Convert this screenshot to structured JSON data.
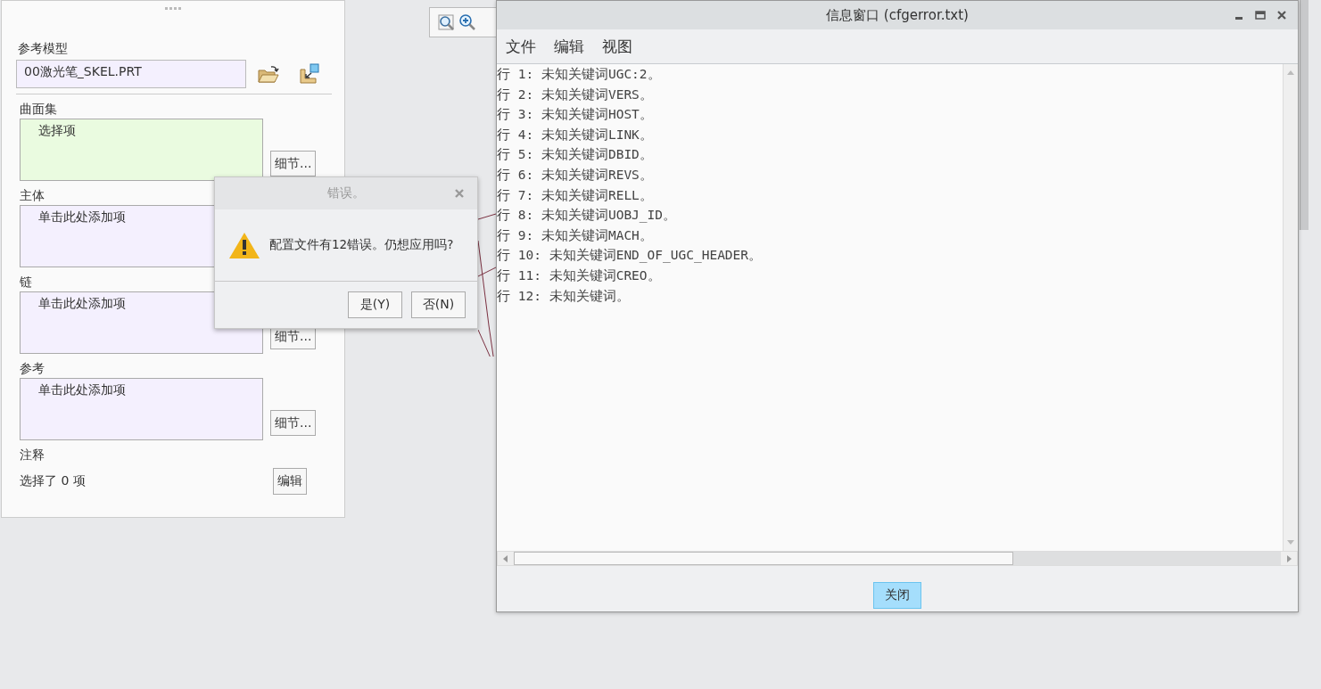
{
  "panel": {
    "model_label": "参考模型",
    "model_value": "00激光笔_SKEL.PRT",
    "sections": [
      {
        "label": "曲面集",
        "text": "选择项",
        "active": true,
        "button": "细节..."
      },
      {
        "label": "主体",
        "text": "单击此处添加项",
        "active": false
      },
      {
        "label": "链",
        "text": "单击此处添加项",
        "active": false,
        "button": "细节..."
      },
      {
        "label": "参考",
        "text": "单击此处添加项",
        "active": false,
        "button": "细节..."
      }
    ],
    "notes_label": "注释",
    "notes_status": "选择了 0 项",
    "notes_button": "编辑"
  },
  "info_window": {
    "title": "信息窗口 (cfgerror.txt)",
    "menu": [
      "文件",
      "编辑",
      "视图"
    ],
    "lines": [
      "行 1: 未知关键词UGC:2。",
      "行 2: 未知关键词VERS。",
      "行 3: 未知关键词HOST。",
      "行 4: 未知关键词LINK。",
      "行 5: 未知关键词DBID。",
      "行 6: 未知关键词REVS。",
      "行 7: 未知关键词RELL。",
      "行 8: 未知关键词UOBJ_ID。",
      "行 9: 未知关键词MACH。",
      "行 10: 未知关键词END_OF_UGC_HEADER。",
      "行 11: 未知关键词CREO。",
      "行 12: 未知关键词。"
    ],
    "close_button": "关闭"
  },
  "error_dialog": {
    "title": "错误。",
    "message": "配置文件有12错误。仍想应用吗?",
    "buttons": [
      "是(Y)",
      "否(N)"
    ]
  }
}
